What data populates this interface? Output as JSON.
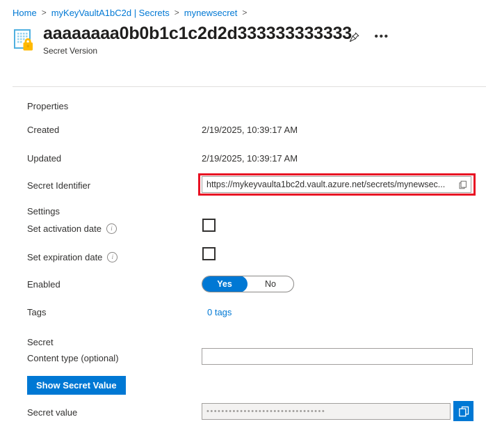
{
  "breadcrumb": {
    "items": [
      {
        "label": "Home"
      },
      {
        "label": "myKeyVaultA1bC2d | Secrets"
      },
      {
        "label": "mynewsecret"
      }
    ],
    "separator": ">"
  },
  "header": {
    "title": "aaaaaaaa0b0b1c1c2d2d333333333333",
    "subtitle": "Secret Version",
    "icon": "key-vault-secret-icon",
    "pin_icon": "pin-icon",
    "more_icon": "ellipsis-icon"
  },
  "properties": {
    "section_label": "Properties",
    "created_label": "Created",
    "created_value": "2/19/2025, 10:39:17 AM",
    "updated_label": "Updated",
    "updated_value": "2/19/2025, 10:39:17 AM",
    "secret_identifier_label": "Secret Identifier",
    "secret_identifier_value": "https://mykeyvaulta1bc2d.vault.azure.net/secrets/mynewsec...",
    "secret_identifier_copy_icon": "copy-icon"
  },
  "settings": {
    "section_label": "Settings",
    "activation_date_label": "Set activation date",
    "activation_date_checked": false,
    "expiration_date_label": "Set expiration date",
    "expiration_date_checked": false,
    "info_icon": "info-icon",
    "enabled_label": "Enabled",
    "enabled_yes": "Yes",
    "enabled_no": "No",
    "enabled_selected": "Yes",
    "tags_label": "Tags",
    "tags_value": "0 tags"
  },
  "secret": {
    "section_label": "Secret",
    "content_type_label": "Content type (optional)",
    "content_type_value": "",
    "content_type_placeholder": "",
    "show_secret_button": "Show Secret Value",
    "secret_value_label": "Secret value",
    "secret_value_masked": "••••••••••••••••••••••••••••••••",
    "secret_value_copy_icon": "copy-icon"
  },
  "annotation": {
    "highlight_color": "#e81123",
    "target": "secret-identifier-field"
  },
  "colors": {
    "accent": "#0078d4",
    "text": "#323130",
    "border": "#a19f9d",
    "divider": "#e1dfdd",
    "lock_gold": "#ffb900"
  }
}
